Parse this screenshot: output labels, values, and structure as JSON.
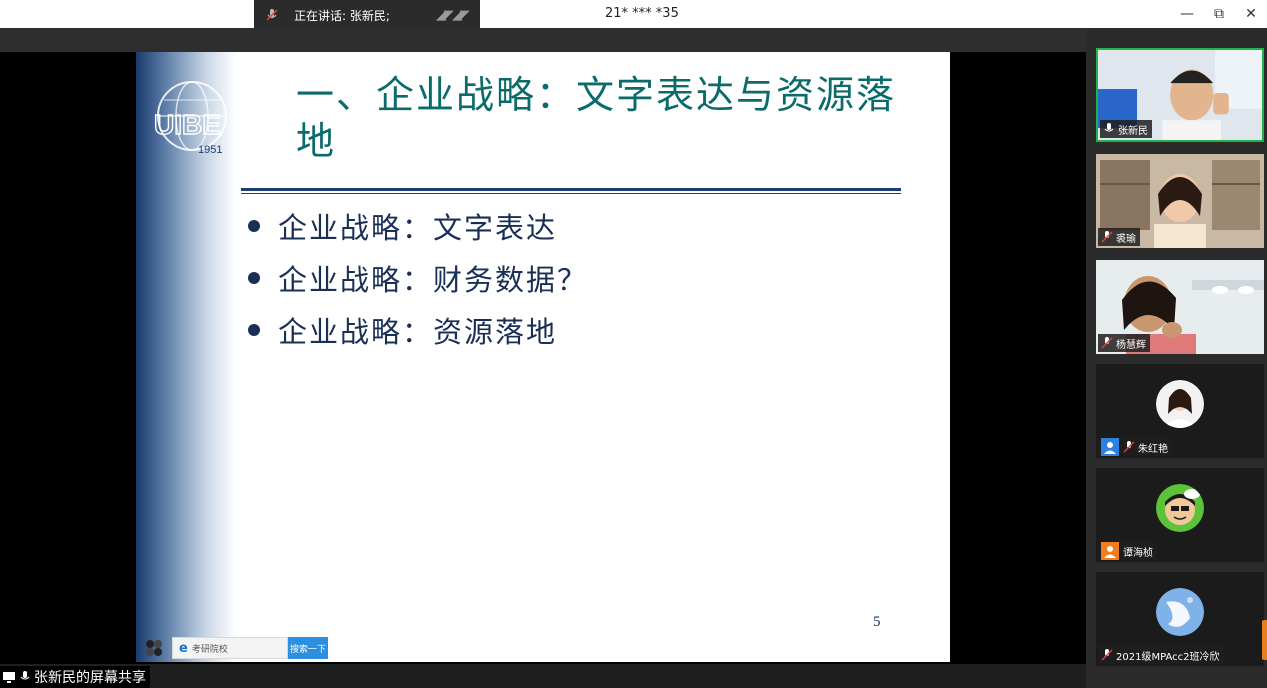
{
  "titlebar": {
    "speaking_label": "正在讲话: 张新民;",
    "meeting_id": "21* *** *35",
    "minimize_label": "—",
    "restore_label": "⧉",
    "close_label": "✕"
  },
  "slide": {
    "title": "一、企业战略：文字表达与资源落地",
    "logo_text": "UIBE",
    "logo_year": "1951",
    "bullets": [
      "企业战略：文字表达",
      "企业战略：财务数据？",
      "企业战略：资源落地"
    ],
    "page_number": "5",
    "taskbar": {
      "search_text": "考研院校",
      "search_button": "搜索一下"
    }
  },
  "participants": [
    {
      "name": "张新民",
      "active": true
    },
    {
      "name": "裘瑜"
    },
    {
      "name": "杨慧辉"
    },
    {
      "name": "朱红艳"
    },
    {
      "name": "谭海桢"
    },
    {
      "name": "2021级MPAcc2班冷欣"
    }
  ],
  "bottom": {
    "share_label": "张新民的屏幕共享"
  },
  "colors": {
    "active_border": "#24b24a",
    "slide_title": "#0b6b6b",
    "slide_text": "#1a2f55",
    "panel_bg": "#2b2b2b"
  }
}
